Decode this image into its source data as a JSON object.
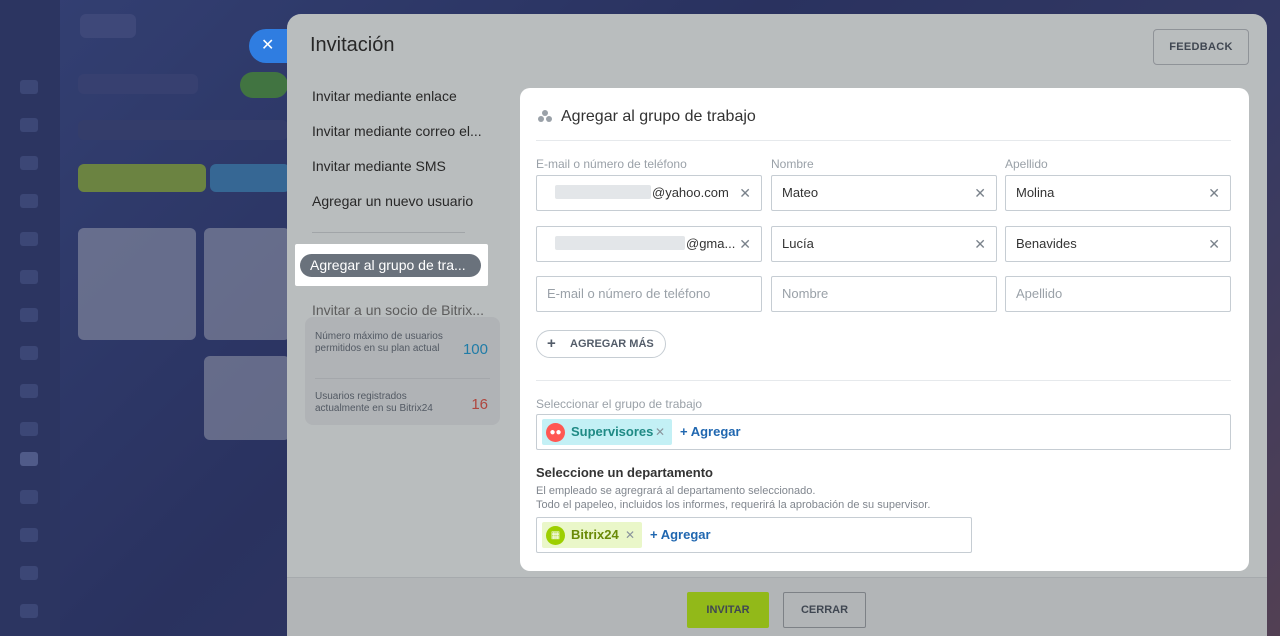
{
  "slider": {
    "title": "Invitación",
    "feedback_label": "FEEDBACK",
    "close_icon": "close-icon"
  },
  "menu": {
    "items": [
      {
        "label": "Invitar mediante enlace"
      },
      {
        "label": "Invitar mediante correo el..."
      },
      {
        "label": "Invitar mediante SMS"
      },
      {
        "label": "Agregar un nuevo usuario"
      }
    ],
    "active": "Agregar al grupo de tra...",
    "partner": "Invitar a un socio de Bitrix..."
  },
  "stats": {
    "max_label": "Número máximo de usuarios permitidos en su plan actual",
    "max_value": "100",
    "registered_label": "Usuarios registrados actualmente en su Bitrix24",
    "registered_value": "16",
    "max_color": "#2fc6f6",
    "registered_color": "#ff5752"
  },
  "form": {
    "heading": "Agregar al grupo de trabajo",
    "col_email": "E-mail o número de teléfono",
    "col_name": "Nombre",
    "col_surname": "Apellido",
    "rows": [
      {
        "email": "@yahoo.com",
        "name": "Mateo",
        "surname": "Molina"
      },
      {
        "email": "@gma...",
        "name": "Lucía",
        "surname": "Benavides"
      }
    ],
    "placeholders": {
      "email": "E-mail o número de teléfono",
      "name": "Nombre",
      "surname": "Apellido"
    },
    "add_more": "AGREGAR MÁS",
    "group_label": "Seleccionar el grupo de trabajo",
    "group_chip": "Supervisores",
    "group_add": "+ Agregar",
    "dept_title": "Seleccione un departamento",
    "dept_desc_1": "El empleado se agregrará al departamento seleccionado.",
    "dept_desc_2": "Todo el papeleo, incluidos los informes, requerirá la aprobación de su supervisor.",
    "dept_chip": "Bitrix24",
    "dept_add": "+ Agregar",
    "group_chip_color": "#c3f0f5",
    "group_icon_color": "#ff5752",
    "dept_chip_color": "#eaf7c9",
    "dept_icon_color": "#9dcf00",
    "group_text_color": "#1f8a85",
    "dept_text_color": "#6a8a08"
  },
  "footer": {
    "invite": "INVITAR",
    "close": "CERRAR",
    "accent": "#bbed21"
  }
}
